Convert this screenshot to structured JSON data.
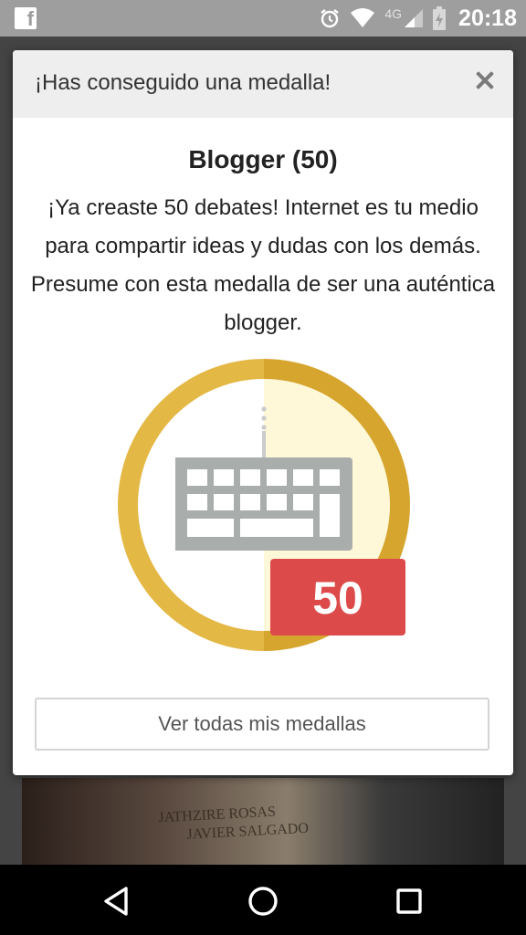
{
  "status_bar": {
    "network": "4G",
    "time": "20:18",
    "icons": [
      "facebook-icon",
      "alarm-icon",
      "wifi-icon",
      "signal-icon",
      "battery-icon"
    ]
  },
  "dialog": {
    "title": "¡Has conseguido una medalla!",
    "medal_name": "Blogger (50)",
    "description": "¡Ya creaste 50 debates! Internet es tu medio para compartir ideas y dudas con los demás. Presume con esta medalla de ser una auténtica blogger.",
    "badge_count": "50",
    "medal_icon": "keyboard-icon",
    "button_label": "Ver todas mis medallas"
  },
  "background": {
    "photo_text": [
      "JATHZIRE ROSAS",
      "JAVIER SALGADO"
    ]
  },
  "navigation": {
    "buttons": [
      "back-icon",
      "home-icon",
      "recents-icon"
    ]
  },
  "colors": {
    "medal_gold": "#e3b845",
    "medal_gold_dark": "#d6a52e",
    "medal_inner_light": "#fef8d8",
    "badge_red": "#dc4a4a",
    "keyboard_gray": "#a9adab"
  }
}
